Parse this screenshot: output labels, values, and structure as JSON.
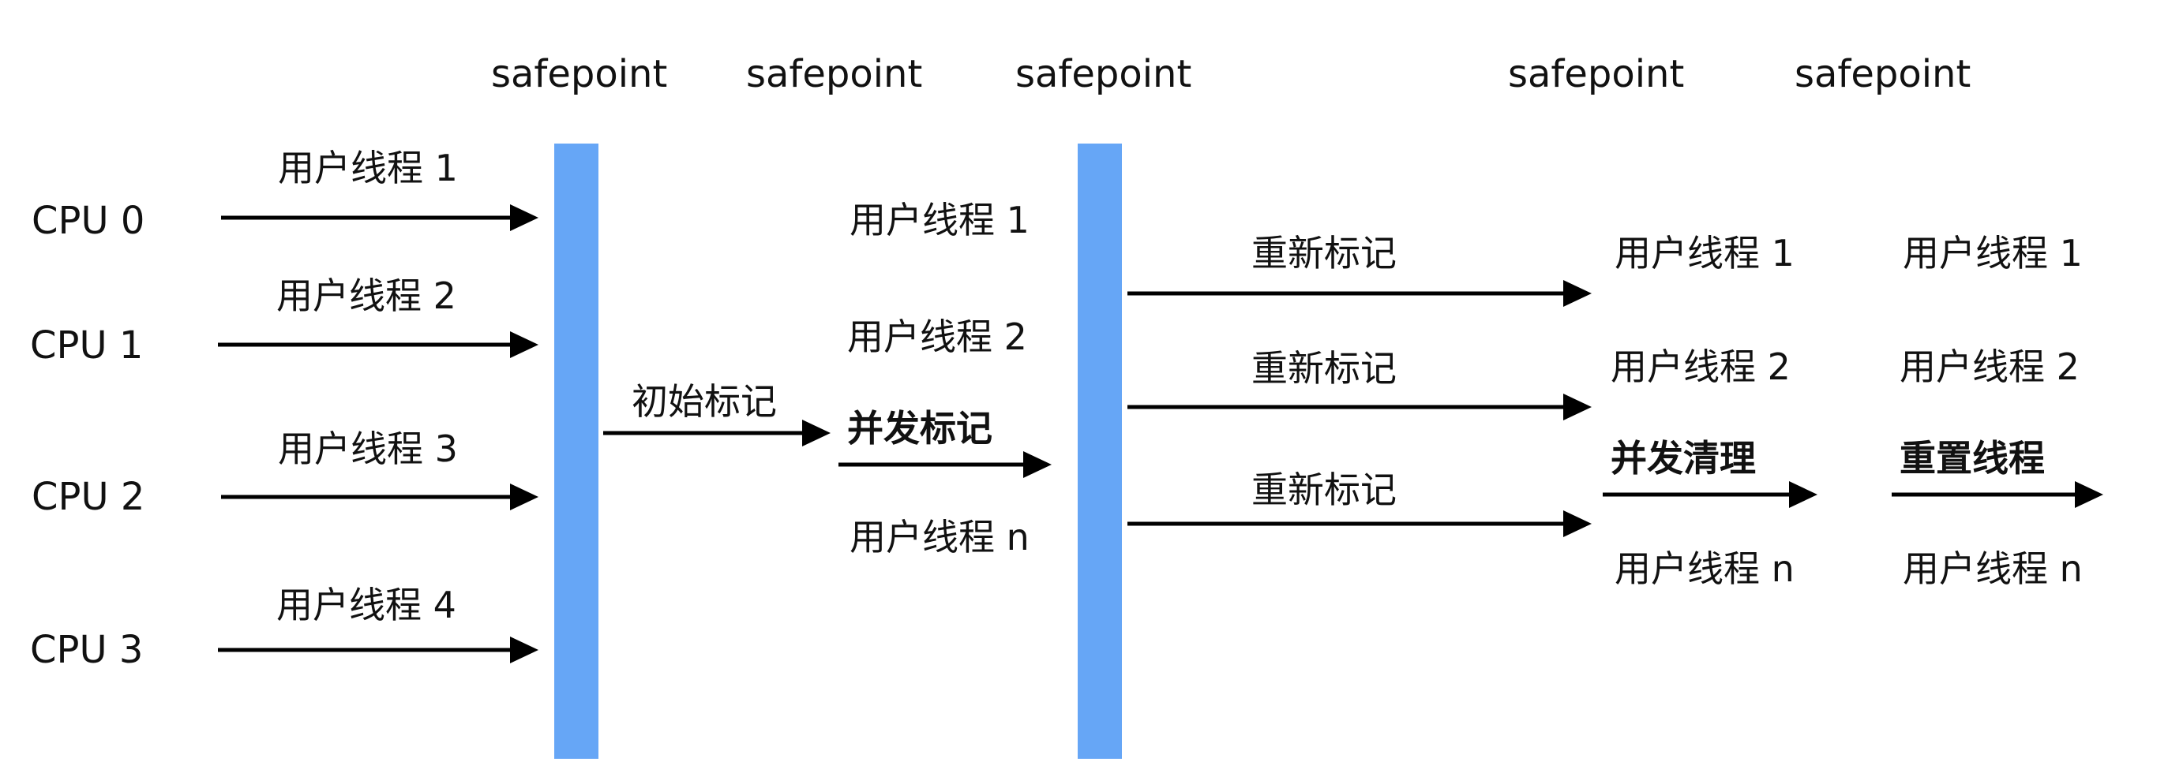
{
  "safepoint_label": "safepoint",
  "cpus": [
    "CPU 0",
    "CPU 1",
    "CPU 2",
    "CPU 3"
  ],
  "initial_threads": [
    "用户线程 1",
    "用户线程 2",
    "用户线程 3",
    "用户线程 4"
  ],
  "phases": {
    "initial_mark": "初始标记",
    "concurrent_mark": "并发标记",
    "remark": "重新标记",
    "concurrent_sweep": "并发清理",
    "reset_threads": "重置线程"
  },
  "concurrent_threads": [
    "用户线程 1",
    "用户线程 2",
    "用户线程 n"
  ],
  "colors": {
    "safepoint_bar": "#66a6f6",
    "arrow": "#000000",
    "text": "#111111"
  }
}
